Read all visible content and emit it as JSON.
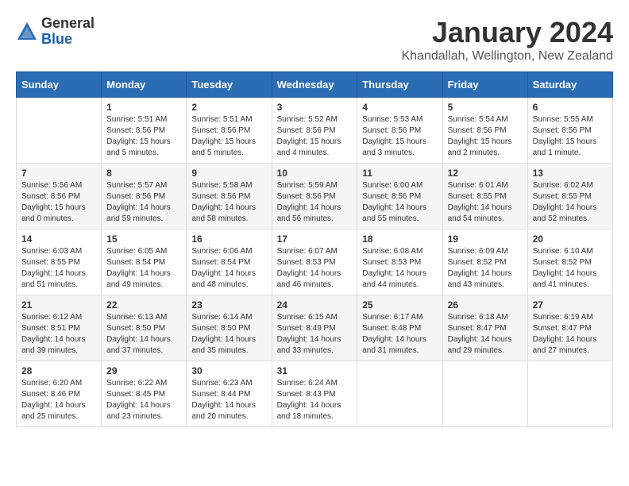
{
  "header": {
    "logo": {
      "general": "General",
      "blue": "Blue"
    },
    "title": "January 2024",
    "location": "Khandallah, Wellington, New Zealand"
  },
  "days_of_week": [
    "Sunday",
    "Monday",
    "Tuesday",
    "Wednesday",
    "Thursday",
    "Friday",
    "Saturday"
  ],
  "weeks": [
    [
      {
        "day": "",
        "info": ""
      },
      {
        "day": "1",
        "info": "Sunrise: 5:51 AM\nSunset: 8:56 PM\nDaylight: 15 hours\nand 5 minutes."
      },
      {
        "day": "2",
        "info": "Sunrise: 5:51 AM\nSunset: 8:56 PM\nDaylight: 15 hours\nand 5 minutes."
      },
      {
        "day": "3",
        "info": "Sunrise: 5:52 AM\nSunset: 8:56 PM\nDaylight: 15 hours\nand 4 minutes."
      },
      {
        "day": "4",
        "info": "Sunrise: 5:53 AM\nSunset: 8:56 PM\nDaylight: 15 hours\nand 3 minutes."
      },
      {
        "day": "5",
        "info": "Sunrise: 5:54 AM\nSunset: 8:56 PM\nDaylight: 15 hours\nand 2 minutes."
      },
      {
        "day": "6",
        "info": "Sunrise: 5:55 AM\nSunset: 8:56 PM\nDaylight: 15 hours\nand 1 minute."
      }
    ],
    [
      {
        "day": "7",
        "info": "Sunrise: 5:56 AM\nSunset: 8:56 PM\nDaylight: 15 hours\nand 0 minutes."
      },
      {
        "day": "8",
        "info": "Sunrise: 5:57 AM\nSunset: 8:56 PM\nDaylight: 14 hours\nand 59 minutes."
      },
      {
        "day": "9",
        "info": "Sunrise: 5:58 AM\nSunset: 8:56 PM\nDaylight: 14 hours\nand 58 minutes."
      },
      {
        "day": "10",
        "info": "Sunrise: 5:59 AM\nSunset: 8:56 PM\nDaylight: 14 hours\nand 56 minutes."
      },
      {
        "day": "11",
        "info": "Sunrise: 6:00 AM\nSunset: 8:56 PM\nDaylight: 14 hours\nand 55 minutes."
      },
      {
        "day": "12",
        "info": "Sunrise: 6:01 AM\nSunset: 8:55 PM\nDaylight: 14 hours\nand 54 minutes."
      },
      {
        "day": "13",
        "info": "Sunrise: 6:02 AM\nSunset: 8:55 PM\nDaylight: 14 hours\nand 52 minutes."
      }
    ],
    [
      {
        "day": "14",
        "info": "Sunrise: 6:03 AM\nSunset: 8:55 PM\nDaylight: 14 hours\nand 51 minutes."
      },
      {
        "day": "15",
        "info": "Sunrise: 6:05 AM\nSunset: 8:54 PM\nDaylight: 14 hours\nand 49 minutes."
      },
      {
        "day": "16",
        "info": "Sunrise: 6:06 AM\nSunset: 8:54 PM\nDaylight: 14 hours\nand 48 minutes."
      },
      {
        "day": "17",
        "info": "Sunrise: 6:07 AM\nSunset: 8:53 PM\nDaylight: 14 hours\nand 46 minutes."
      },
      {
        "day": "18",
        "info": "Sunrise: 6:08 AM\nSunset: 8:53 PM\nDaylight: 14 hours\nand 44 minutes."
      },
      {
        "day": "19",
        "info": "Sunrise: 6:09 AM\nSunset: 8:52 PM\nDaylight: 14 hours\nand 43 minutes."
      },
      {
        "day": "20",
        "info": "Sunrise: 6:10 AM\nSunset: 8:52 PM\nDaylight: 14 hours\nand 41 minutes."
      }
    ],
    [
      {
        "day": "21",
        "info": "Sunrise: 6:12 AM\nSunset: 8:51 PM\nDaylight: 14 hours\nand 39 minutes."
      },
      {
        "day": "22",
        "info": "Sunrise: 6:13 AM\nSunset: 8:50 PM\nDaylight: 14 hours\nand 37 minutes."
      },
      {
        "day": "23",
        "info": "Sunrise: 6:14 AM\nSunset: 8:50 PM\nDaylight: 14 hours\nand 35 minutes."
      },
      {
        "day": "24",
        "info": "Sunrise: 6:15 AM\nSunset: 8:49 PM\nDaylight: 14 hours\nand 33 minutes."
      },
      {
        "day": "25",
        "info": "Sunrise: 6:17 AM\nSunset: 8:48 PM\nDaylight: 14 hours\nand 31 minutes."
      },
      {
        "day": "26",
        "info": "Sunrise: 6:18 AM\nSunset: 8:47 PM\nDaylight: 14 hours\nand 29 minutes."
      },
      {
        "day": "27",
        "info": "Sunrise: 6:19 AM\nSunset: 8:47 PM\nDaylight: 14 hours\nand 27 minutes."
      }
    ],
    [
      {
        "day": "28",
        "info": "Sunrise: 6:20 AM\nSunset: 8:46 PM\nDaylight: 14 hours\nand 25 minutes."
      },
      {
        "day": "29",
        "info": "Sunrise: 6:22 AM\nSunset: 8:45 PM\nDaylight: 14 hours\nand 23 minutes."
      },
      {
        "day": "30",
        "info": "Sunrise: 6:23 AM\nSunset: 8:44 PM\nDaylight: 14 hours\nand 20 minutes."
      },
      {
        "day": "31",
        "info": "Sunrise: 6:24 AM\nSunset: 8:43 PM\nDaylight: 14 hours\nand 18 minutes."
      },
      {
        "day": "",
        "info": ""
      },
      {
        "day": "",
        "info": ""
      },
      {
        "day": "",
        "info": ""
      }
    ]
  ]
}
